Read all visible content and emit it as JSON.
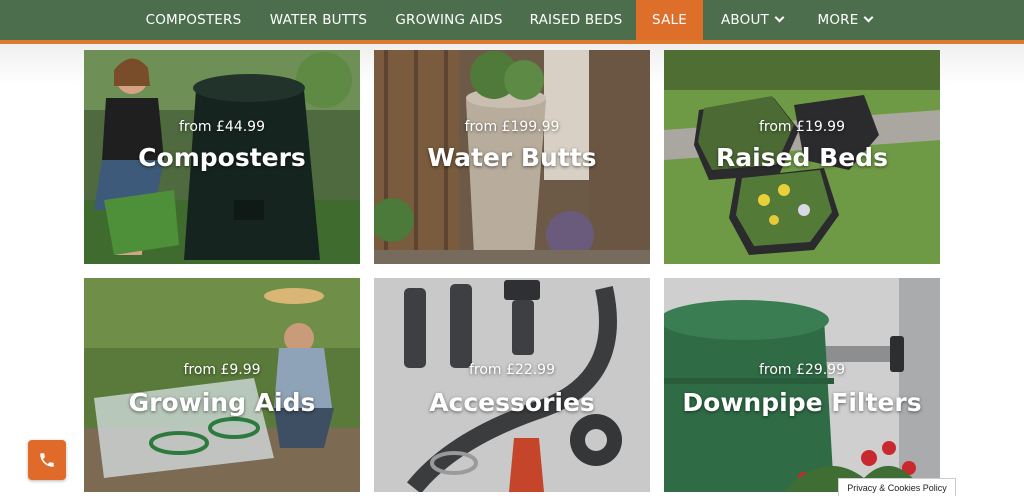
{
  "nav": {
    "items": [
      {
        "label": "COMPOSTERS"
      },
      {
        "label": "WATER BUTTS"
      },
      {
        "label": "GROWING AIDS"
      },
      {
        "label": "RAISED BEDS"
      },
      {
        "label": "SALE"
      },
      {
        "label": "ABOUT"
      },
      {
        "label": "MORE"
      }
    ],
    "dropdown_icon": "chevron-down-icon"
  },
  "colors": {
    "nav_bg": "#4d6e4c",
    "accent": "#de6f2a"
  },
  "tiles": [
    {
      "price": "from £44.99",
      "name": "Composters"
    },
    {
      "price": "from £199.99",
      "name": "Water Butts"
    },
    {
      "price": "from £19.99",
      "name": "Raised Beds"
    },
    {
      "price": "from £9.99",
      "name": "Growing Aids"
    },
    {
      "price": "from £22.99",
      "name": "Accessories"
    },
    {
      "price": "from £29.99",
      "name": "Downpipe Filters"
    }
  ],
  "phone_button": {
    "icon": "phone-icon"
  },
  "cookie": {
    "label": "Privacy & Cookies Policy"
  }
}
